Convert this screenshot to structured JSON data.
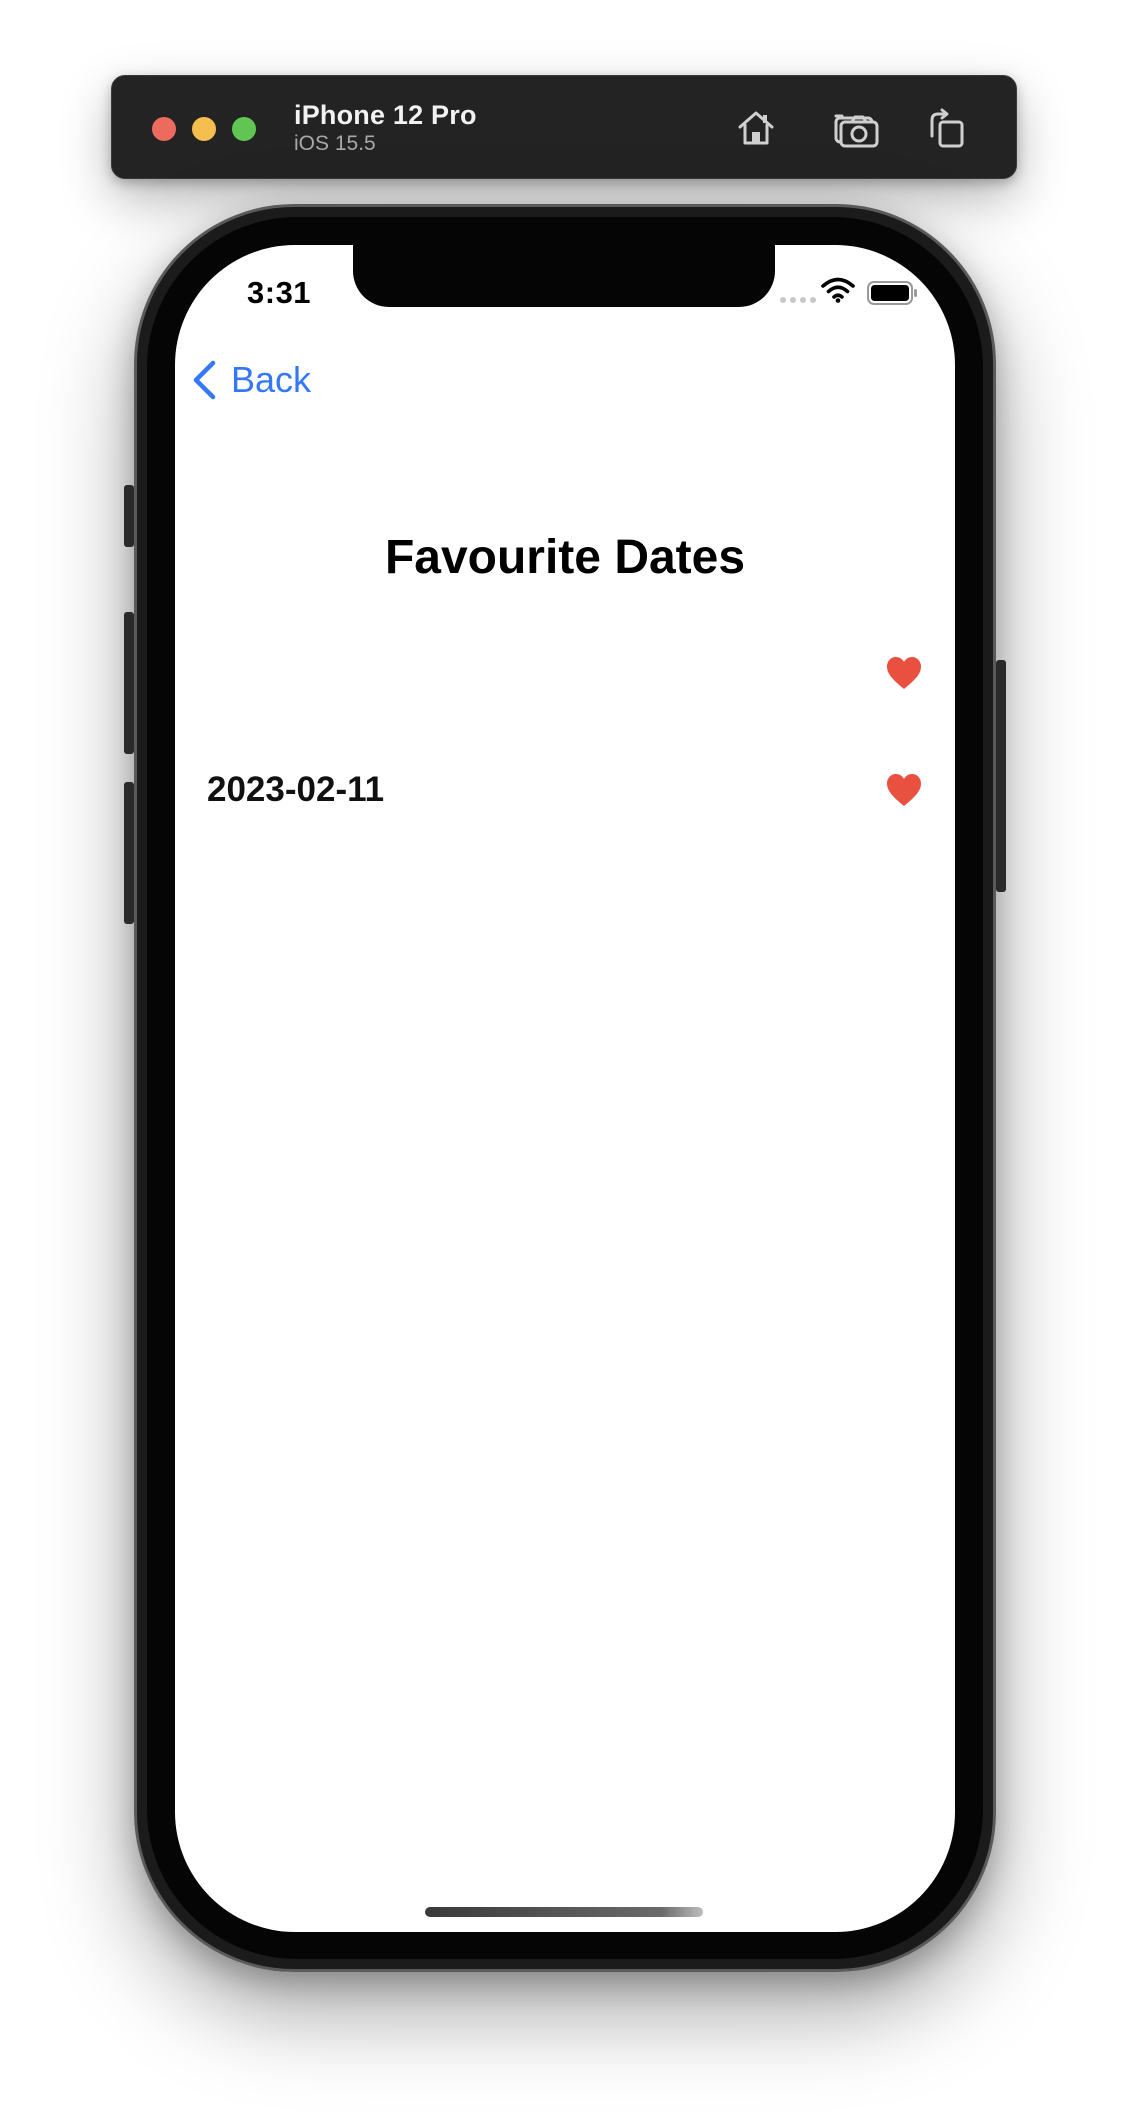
{
  "simulator": {
    "device_name": "iPhone 12 Pro",
    "os_version": "iOS 15.5",
    "buttons": {
      "home_icon": "house-icon",
      "screenshot_icon": "camera-icon",
      "rotate_icon": "rotate-icon"
    }
  },
  "status_bar": {
    "time": "3:31"
  },
  "nav": {
    "back_label": "Back"
  },
  "page": {
    "title": "Favourite Dates",
    "rows": [
      {
        "label": "",
        "favourite": true
      },
      {
        "label": "2023-02-11",
        "favourite": true
      }
    ]
  },
  "colors": {
    "accent": "#3478f6",
    "heart": "#e9503f"
  }
}
